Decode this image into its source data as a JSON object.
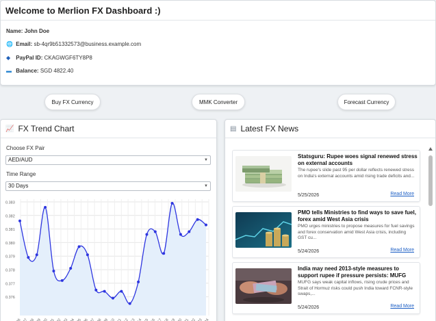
{
  "welcome": {
    "title": "Welcome to Merlion FX Dashboard :)",
    "name_label": "Name:",
    "name_value": "John Doe",
    "email_label": "Email:",
    "email_value": "sb-4qr9b51332573@business.example.com",
    "paypal_label": "PayPal ID:",
    "paypal_value": "CKAGWGF6TY8P8",
    "balance_label": "Balance:",
    "balance_value": "SGD 4822.40"
  },
  "actions": {
    "buy_label": "Buy FX Currency",
    "converter_label": "MMK Converter",
    "forecast_label": "Forecast Currency"
  },
  "trend": {
    "title": "FX Trend Chart",
    "pair_label": "Choose FX Pair",
    "pair_value": "AED/AUD",
    "range_label": "Time Range",
    "range_value": "30 Days"
  },
  "chart_data": {
    "type": "line",
    "title": "",
    "xlabel": "",
    "ylabel": "",
    "y_ticks": [
      "0.383",
      "0.382",
      "0.381",
      "0.380",
      "0.379",
      "0.378",
      "0.377",
      "0.376"
    ],
    "x_tick_labels": [
      "-26",
      "-27",
      "-28",
      "-29",
      "-30",
      "-01",
      "-02",
      "-03",
      "-04",
      "-05",
      "-06",
      "-07",
      "-08",
      "-09",
      "-10",
      "-11",
      "-12",
      "-13",
      "-14",
      "-15",
      "-16",
      "-17",
      "-18",
      "-19",
      "-20",
      "-21",
      "-22",
      "-23",
      "-24"
    ],
    "values": [
      0.3816,
      0.3789,
      0.3791,
      0.3826,
      0.3779,
      0.3772,
      0.3781,
      0.3797,
      0.3791,
      0.3765,
      0.3764,
      0.3759,
      0.3764,
      0.3755,
      0.3771,
      0.3806,
      0.3808,
      0.3792,
      0.3829,
      0.3806,
      0.3808,
      0.3817,
      0.3813
    ],
    "ylim": [
      0.3755,
      0.3835
    ],
    "grid": true,
    "line_color": "#2e36e0",
    "fill_color": "#e4effb"
  },
  "news": {
    "title": "Latest FX News",
    "items": [
      {
        "title": "Statsguru: Rupee woes signal renewed stress on external accounts",
        "desc": "The rupee's slide past 95 per dollar reflects renewed stress on India's external accounts amid rising trade deficits and...",
        "date": "5/25/2026",
        "link": "Read More",
        "thumb": "cash-stack"
      },
      {
        "title": "PMO tells Ministries to find ways to save fuel, forex amid West Asia crisis",
        "desc": "PMO urges ministries to propose measures for fuel savings and forex conservation amid West Asia crisis, including GST cu...",
        "date": "5/24/2026",
        "link": "Read More",
        "thumb": "coins-chart"
      },
      {
        "title": "India may need 2013-style measures to support rupee if pressure persists: MUFG",
        "desc": "MUFG says weak capital inflows, rising crude prices and Strait of Hormuz risks could push India toward FCNR-style swaps,...",
        "date": "5/24/2026",
        "link": "Read More",
        "thumb": "hands-money"
      }
    ]
  }
}
